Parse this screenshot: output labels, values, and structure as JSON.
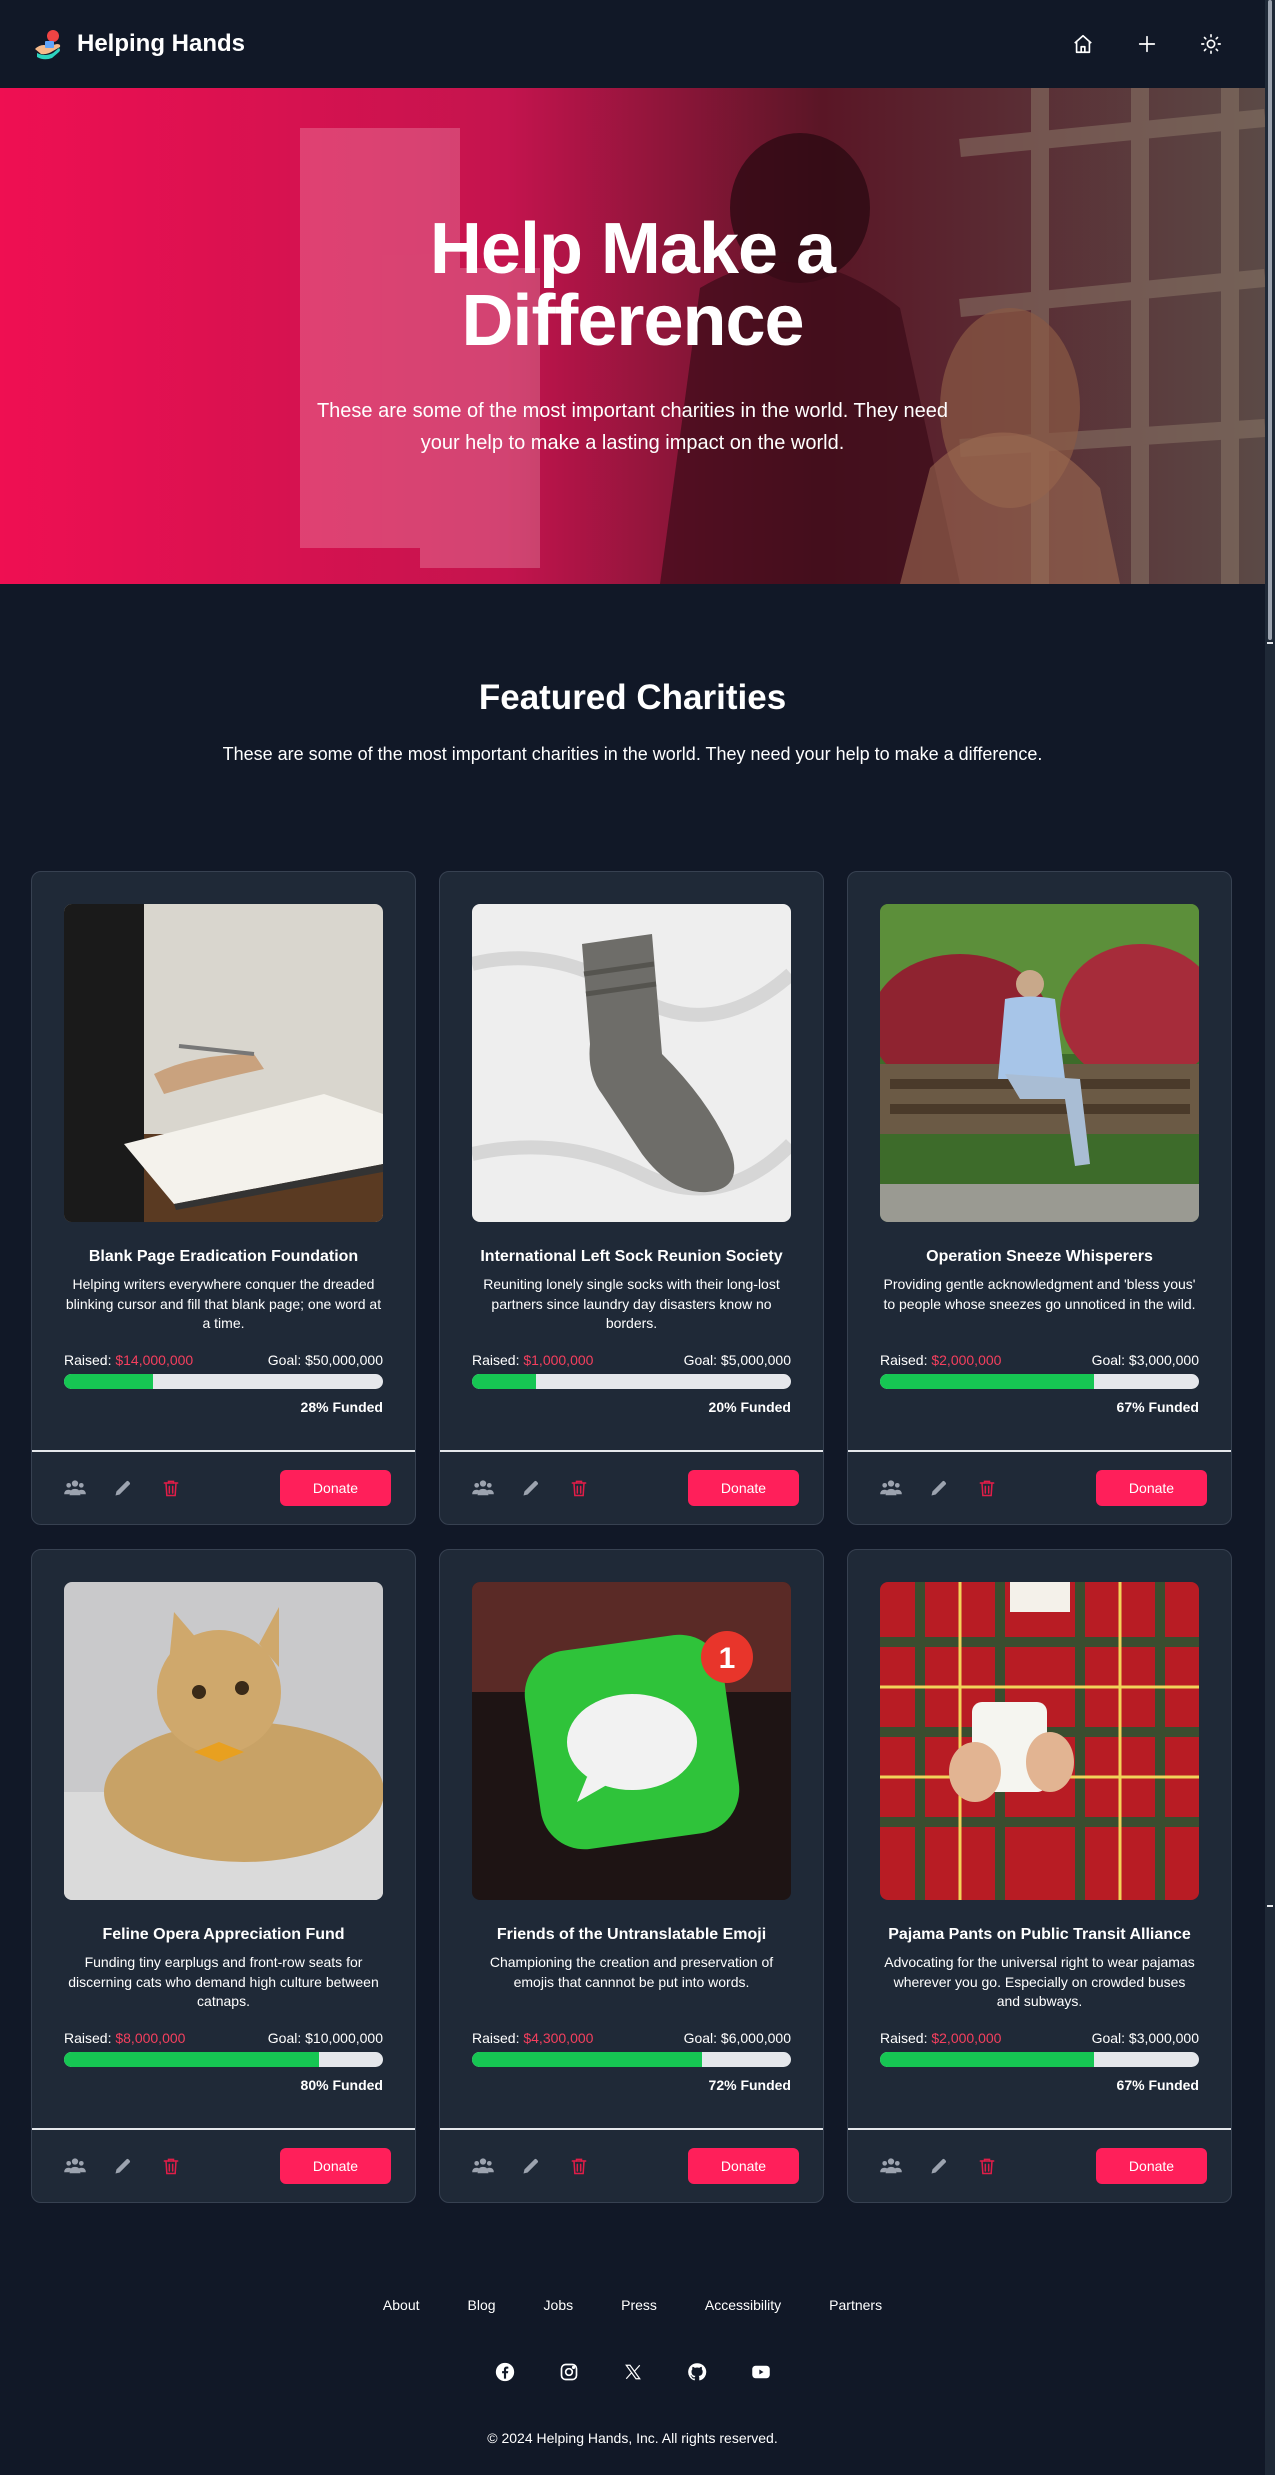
{
  "brand": {
    "name": "Helping Hands",
    "logo_icon": "hands-heart-logo-icon"
  },
  "nav": {
    "icons": [
      "home-icon",
      "plus-icon",
      "sun-icon"
    ]
  },
  "hero": {
    "title": "Help Make a Difference",
    "subtitle": "These are some of the most important charities in the world. They need your help to make a lasting impact on the world."
  },
  "featured": {
    "title": "Featured Charities",
    "subtitle": "These are some of the most important charities in the world. They need your help to make a difference."
  },
  "labels": {
    "raised": "Raised:",
    "goal": "Goal:",
    "funded_suffix": "Funded",
    "donate": "Donate"
  },
  "charities": [
    {
      "name": "Blank Page Eradication Foundation",
      "desc": "Helping writers everywhere conquer the dreaded blinking cursor and fill that blank page; one word at a time.",
      "raised": "$14,000,000",
      "goal": "Goal: $50,000,000",
      "funded": "28% Funded",
      "fraction": 0.28,
      "image": "notebook-and-pen-photo"
    },
    {
      "name": "International Left Sock Reunion Society",
      "desc": "Reuniting lonely single socks with their long-lost partners since laundry day disasters know no borders.",
      "raised": "$1,000,000",
      "goal": "Goal: $5,000,000",
      "funded": "20% Funded",
      "fraction": 0.2,
      "image": "grey-knitted-sock-photo"
    },
    {
      "name": "Operation Sneeze Whisperers",
      "desc": "Providing gentle acknowledgment and 'bless yous' to people whose sneezes go unnoticed in the wild.",
      "raised": "$2,000,000",
      "goal": "Goal: $3,000,000",
      "funded": "67% Funded",
      "fraction": 0.67,
      "image": "man-on-park-bench-photo"
    },
    {
      "name": "Feline Opera Appreciation Fund",
      "desc": "Funding tiny earplugs and front-row seats for discerning cats who demand high culture between catnaps.",
      "raised": "$8,000,000",
      "goal": "Goal: $10,000,000",
      "funded": "80% Funded",
      "fraction": 0.8,
      "image": "cat-with-bowtie-photo"
    },
    {
      "name": "Friends of the Untranslatable Emoji",
      "desc": "Championing the creation and preservation of emojis that cannnot be put into words.",
      "raised": "$4,300,000",
      "goal": "Goal: $6,000,000",
      "funded": "72% Funded",
      "fraction": 0.72,
      "image": "messages-app-icon-photo"
    },
    {
      "name": "Pajama Pants on Public Transit Alliance",
      "desc": "Advocating for the universal right to wear pajamas wherever you go. Especially on crowded buses and subways.",
      "raised": "$2,000,000",
      "goal": "Goal: $3,000,000",
      "funded": "67% Funded",
      "fraction": 0.67,
      "image": "plaid-pajamas-mug-photo"
    }
  ],
  "card_actions": [
    "users-icon",
    "pencil-icon",
    "trash-icon"
  ],
  "footer": {
    "links": [
      "About",
      "Blog",
      "Jobs",
      "Press",
      "Accessibility",
      "Partners"
    ],
    "socials": [
      "facebook-icon",
      "instagram-icon",
      "x-icon",
      "github-icon",
      "youtube-icon"
    ],
    "copyright": "© 2024 Helping Hands, Inc. All rights reserved."
  },
  "colors": {
    "background": "#111827",
    "card": "#1f2937",
    "accent": "#ff1f5a",
    "progress": "#16c653",
    "raised_text": "#f43f5e"
  }
}
